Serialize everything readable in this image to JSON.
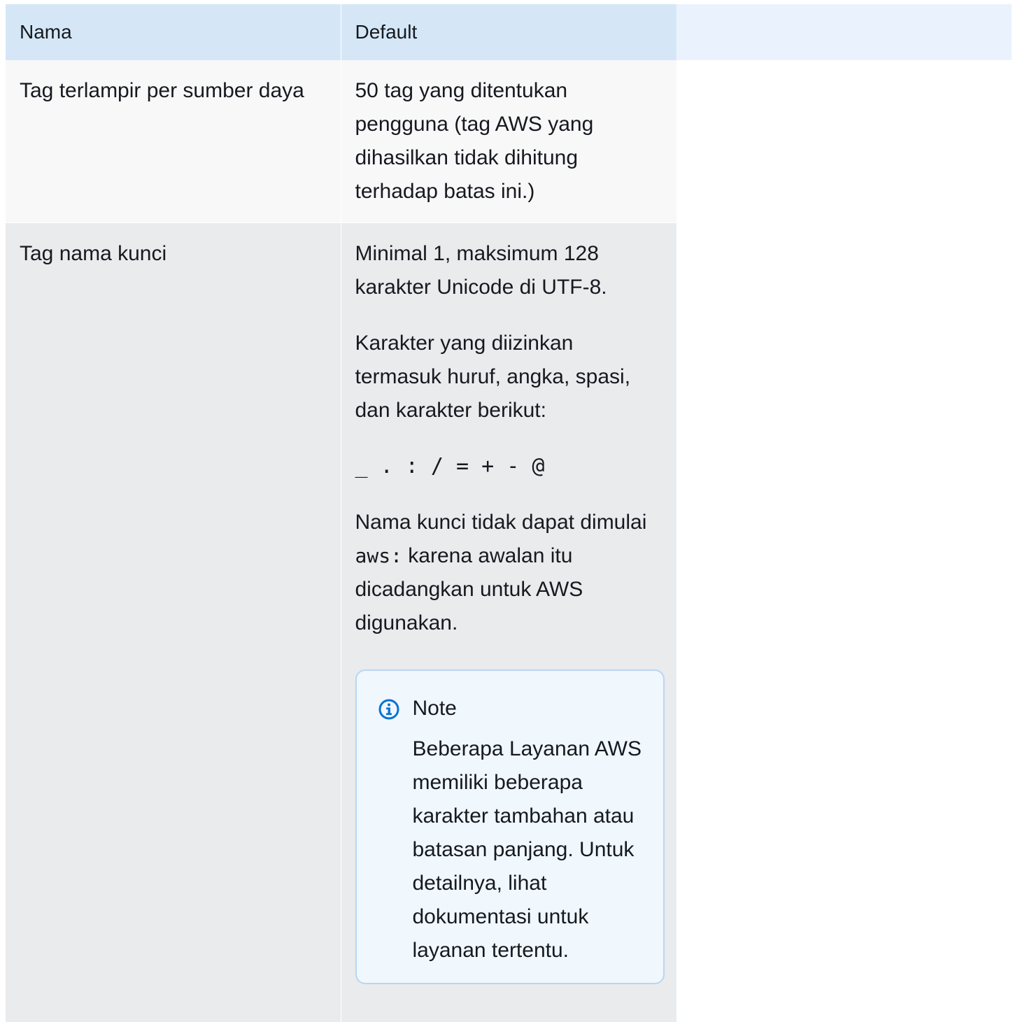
{
  "table": {
    "headers": {
      "name": "Nama",
      "default": "Default"
    },
    "rows": [
      {
        "name": "Tag terlampir per sumber daya",
        "default": "50 tag yang ditentukan pengguna (tag AWS yang dihasilkan tidak dihitung terhadap batas ini.)"
      },
      {
        "name": "Tag nama kunci",
        "default_paragraph_1": "Minimal 1, maksimum 128 karakter Unicode di UTF-8.",
        "default_paragraph_2": "Karakter yang diizinkan termasuk huruf, angka, spasi, dan karakter berikut:",
        "allowed_characters": "_ . : / = + - @",
        "default_paragraph_3_before": "Nama kunci tidak dapat dimulai ",
        "default_paragraph_3_code": "aws:",
        "default_paragraph_3_after": " karena awalan itu dicadangkan untuk AWS digunakan.",
        "note": {
          "icon": "info-icon",
          "title": "Note",
          "body": "Beberapa Layanan AWS memiliki beberapa karakter tambahan atau batasan panjang. Untuk detailnya, lihat dokumentasi untuk layanan tertentu."
        }
      }
    ]
  },
  "colors": {
    "header_bg": "#d5e7f7",
    "row_alt_bg": "#f8f8f8",
    "row_bg": "#e9ebed",
    "note_border": "#b8d6f3",
    "note_bg": "#f0f7fd",
    "info_icon": "#0972d3"
  }
}
